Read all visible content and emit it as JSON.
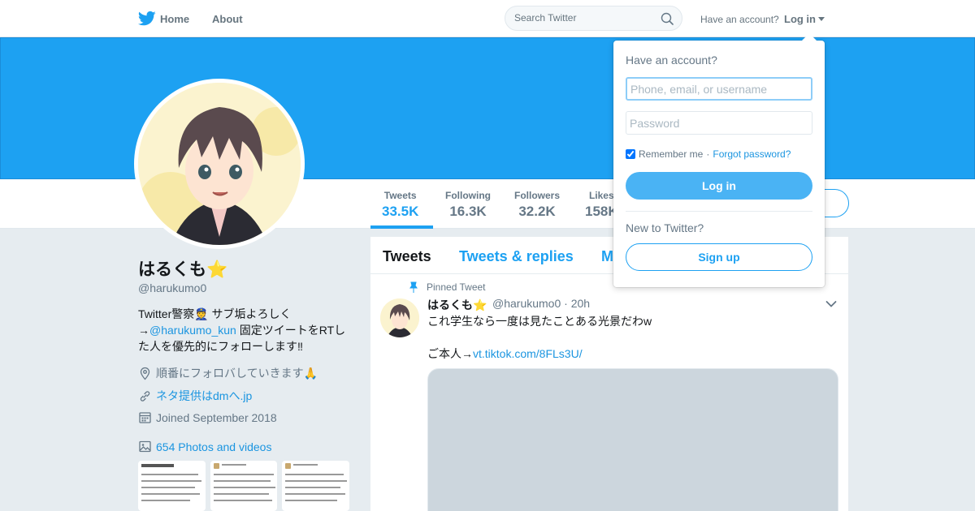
{
  "nav": {
    "home_label": "Home",
    "about_label": "About",
    "search_placeholder": "Search Twitter",
    "have_account_text": "Have an account?",
    "login_label": "Log in"
  },
  "profile": {
    "name": "はるくも",
    "name_emoji": "⭐",
    "handle": "@harukumo0",
    "bio_line1": "Twitter警察👮 サブ垢よろしく",
    "bio_arrow": "→",
    "bio_mention": "@harukumo_kun",
    "bio_line2": " 固定ツイートをRTした人を優先的にフォローします‼",
    "location": "順番にフォロバしていきます🙏",
    "website": "ネタ提供はdmへ.jp",
    "joined": "Joined September 2018",
    "photos_label": "654 Photos and videos"
  },
  "stats": [
    {
      "label": "Tweets",
      "value": "33.5K"
    },
    {
      "label": "Following",
      "value": "16.3K"
    },
    {
      "label": "Followers",
      "value": "32.2K"
    },
    {
      "label": "Likes",
      "value": "158K"
    }
  ],
  "timeline": {
    "tabs": [
      "Tweets",
      "Tweets & replies",
      "Media"
    ],
    "pinned_label": "Pinned Tweet",
    "tweet": {
      "name": "はるくも⭐",
      "handle_time": "@harukumo0 · 20h",
      "text_line1": "これ学生なら一度は見たことある光景だわw",
      "text_prefix": "ご本人→",
      "link": "vt.tiktok.com/8FLs3U/"
    }
  },
  "login_dropdown": {
    "title": "Have an account?",
    "username_placeholder": "Phone, email, or username",
    "password_placeholder": "Password",
    "remember_label": "Remember me",
    "separator": "·",
    "forgot_label": "Forgot password?",
    "login_button": "Log in",
    "new_text": "New to Twitter?",
    "signup_button": "Sign up"
  },
  "colors": {
    "brand": "#1da1f2",
    "link": "#1b95e0",
    "button_fill": "#4ab3f4"
  },
  "icons": [
    "twitter-bird-icon",
    "search-icon",
    "caret-down-icon",
    "pin-icon",
    "location-icon",
    "link-icon",
    "calendar-icon",
    "photo-icon",
    "chevron-down-icon"
  ]
}
